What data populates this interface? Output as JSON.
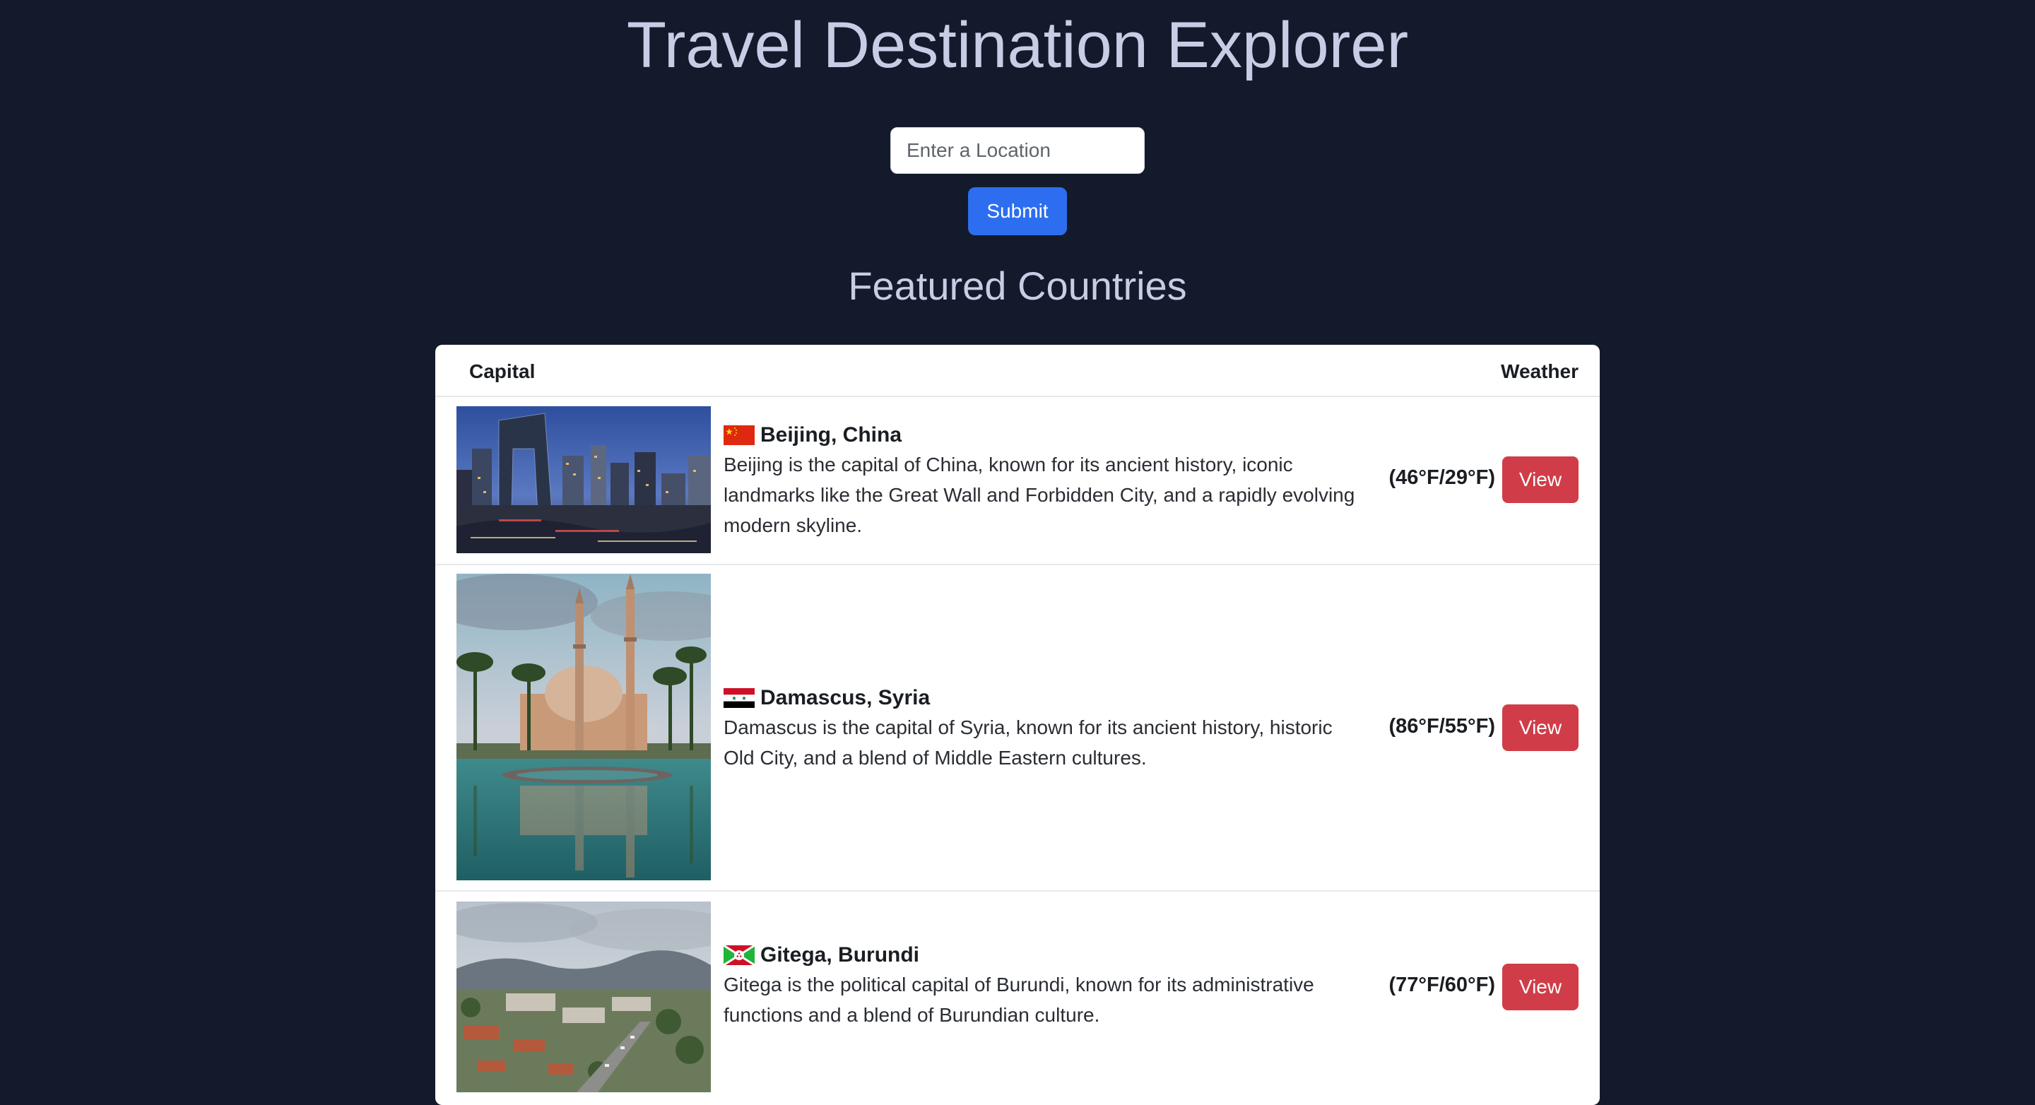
{
  "header": {
    "title": "Travel Destination Explorer"
  },
  "search": {
    "placeholder": "Enter a Location",
    "value": "",
    "submit_label": "Submit"
  },
  "featured": {
    "title": "Featured Countries",
    "columns": {
      "capital": "Capital",
      "weather": "Weather"
    },
    "rows": [
      {
        "name": "Beijing, China",
        "description": "Beijing is the capital of China, known for its ancient history, iconic landmarks like the Great Wall and Forbidden City, and a rapidly evolving modern skyline.",
        "weather": "(46°F/29°F)",
        "view_label": "View",
        "flag_icon": "china-flag-icon",
        "image": "beijing-skyline-photo"
      },
      {
        "name": "Damascus, Syria",
        "description": "Damascus is the capital of Syria, known for its ancient history, historic Old City, and a blend of Middle Eastern cultures.",
        "weather": "(86°F/55°F)",
        "view_label": "View",
        "flag_icon": "syria-flag-icon",
        "image": "damascus-mosque-photo"
      },
      {
        "name": "Gitega, Burundi",
        "description": "Gitega is the political capital of Burundi, known for its administrative functions and a blend of Burundian culture.",
        "weather": "(77°F/60°F)",
        "view_label": "View",
        "flag_icon": "burundi-flag-icon",
        "image": "gitega-town-photo"
      }
    ]
  },
  "colors": {
    "background": "#131a2b",
    "title_text": "#c8cde6",
    "submit_button": "#2d6ef0",
    "view_button": "#d03d48",
    "card": "#ffffff"
  }
}
